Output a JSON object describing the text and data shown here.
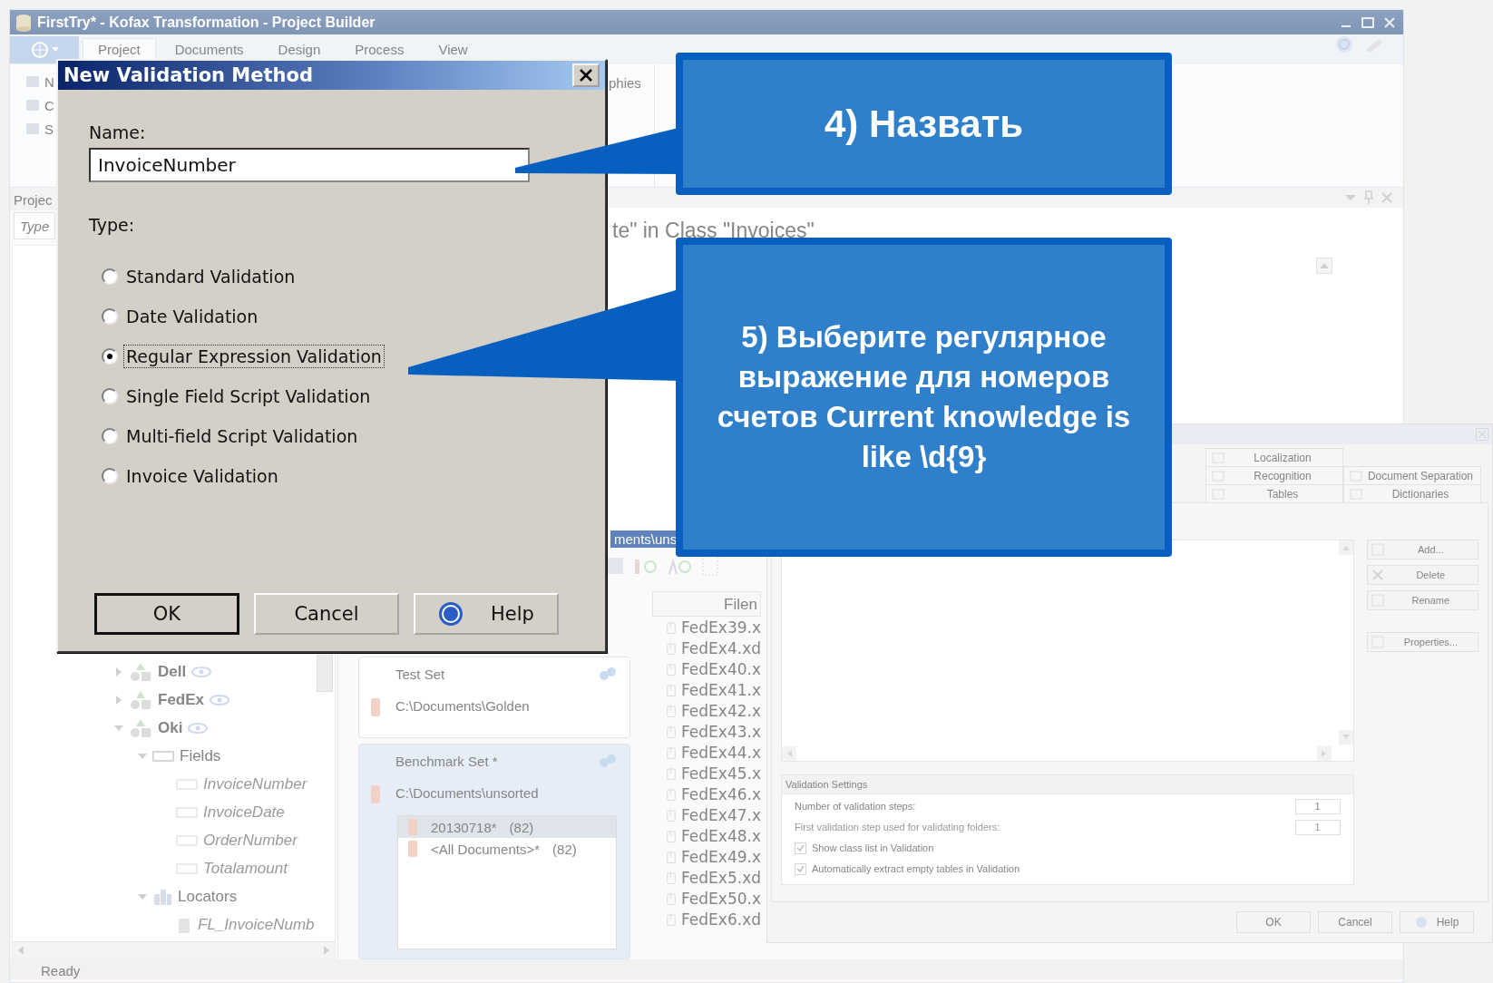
{
  "app": {
    "title": "FirstTry* - Kofax Transformation - Project Builder",
    "ribbon_tabs": [
      {
        "label": "Project",
        "selected": true
      },
      {
        "label": "Documents",
        "selected": false
      },
      {
        "label": "Design",
        "selected": false
      },
      {
        "label": "Process",
        "selected": false
      },
      {
        "label": "View",
        "selected": false
      }
    ],
    "ribbon_items": [
      "N",
      "C",
      "S"
    ],
    "ribbon_group_label": "phies",
    "project_panel": {
      "title": "Projec",
      "search_placeholder": "Type",
      "tree": [
        {
          "label": "Dell",
          "kind": "class",
          "expanded": false
        },
        {
          "label": "FedEx",
          "kind": "class",
          "expanded": false
        },
        {
          "label": "Oki",
          "kind": "class",
          "expanded": true,
          "children": [
            {
              "label": "Fields",
              "kind": "folder",
              "expanded": true,
              "children": [
                {
                  "label": "InvoiceNumber",
                  "kind": "field"
                },
                {
                  "label": "InvoiceDate",
                  "kind": "field"
                },
                {
                  "label": "OrderNumber",
                  "kind": "field"
                },
                {
                  "label": "Totalamount",
                  "kind": "field"
                }
              ]
            },
            {
              "label": "Locators",
              "kind": "locators",
              "expanded": true,
              "children": [
                {
                  "label": "FL_InvoiceNumb",
                  "kind": "locator"
                }
              ]
            }
          ]
        }
      ]
    },
    "class_heading": "te\" in Class \"Invoices\"",
    "path_bar": "ments\\uns",
    "document_sets": [
      {
        "name": "Test Set",
        "path": "C:\\Documents\\Golden",
        "selected": false
      },
      {
        "name": "Benchmark Set *",
        "path": "C:\\Documents\\unsorted",
        "selected": true,
        "items": [
          {
            "name": "20130718*",
            "count": "(82)",
            "selected": true
          },
          {
            "name": "<All Documents>*",
            "count": "(82)",
            "selected": false
          }
        ]
      }
    ],
    "file_list": {
      "column": "Filen",
      "files": [
        "FedEx39.x",
        "FedEx4.xd",
        "FedEx40.x",
        "FedEx41.x",
        "FedEx42.x",
        "FedEx43.x",
        "FedEx44.x",
        "FedEx45.x",
        "FedEx46.x",
        "FedEx47.x",
        "FedEx48.x",
        "FedEx49.x",
        "FedEx5.xd",
        "FedEx50.x",
        "FedEx6.xd"
      ]
    },
    "status": "Ready"
  },
  "project_settings": {
    "tab_rows": [
      [
        {
          "label": "Localization"
        }
      ],
      [
        {
          "label": "Recognition"
        },
        {
          "label": "Document Separation"
        }
      ],
      [
        {
          "label": "Tables"
        },
        {
          "label": "Dictionaries"
        }
      ]
    ],
    "buttons": [
      "Add...",
      "Delete",
      "Rename",
      "Properties..."
    ],
    "settings_title": "Validation Settings",
    "spinners": [
      {
        "label": "Number of validation steps:",
        "value": "1",
        "disabled": false
      },
      {
        "label": "First validation step used for validating folders:",
        "value": "1",
        "disabled": true
      }
    ],
    "checkboxes": [
      {
        "label": "Show class list in Validation",
        "checked": true
      },
      {
        "label": "Automatically extract empty tables in Validation",
        "checked": true
      }
    ],
    "footer_buttons": [
      "OK",
      "Cancel",
      "Help"
    ]
  },
  "dialog": {
    "title": "New Validation Method",
    "name_label": "Name:",
    "name_value": "InvoiceNumber",
    "type_label": "Type:",
    "types": [
      {
        "label": "Standard Validation",
        "selected": false
      },
      {
        "label": "Date Validation",
        "selected": false
      },
      {
        "label": "Regular Expression Validation",
        "selected": true
      },
      {
        "label": "Single Field Script Validation",
        "selected": false
      },
      {
        "label": "Multi-field Script Validation",
        "selected": false
      },
      {
        "label": "Invoice Validation",
        "selected": false
      }
    ],
    "buttons": [
      "OK",
      "Cancel",
      "Help"
    ]
  },
  "callouts": [
    {
      "text": "4) Назвать"
    },
    {
      "text": "5) Выберите регулярное выражение для номеров счетов Current knowledge is like \\d{9}"
    }
  ]
}
